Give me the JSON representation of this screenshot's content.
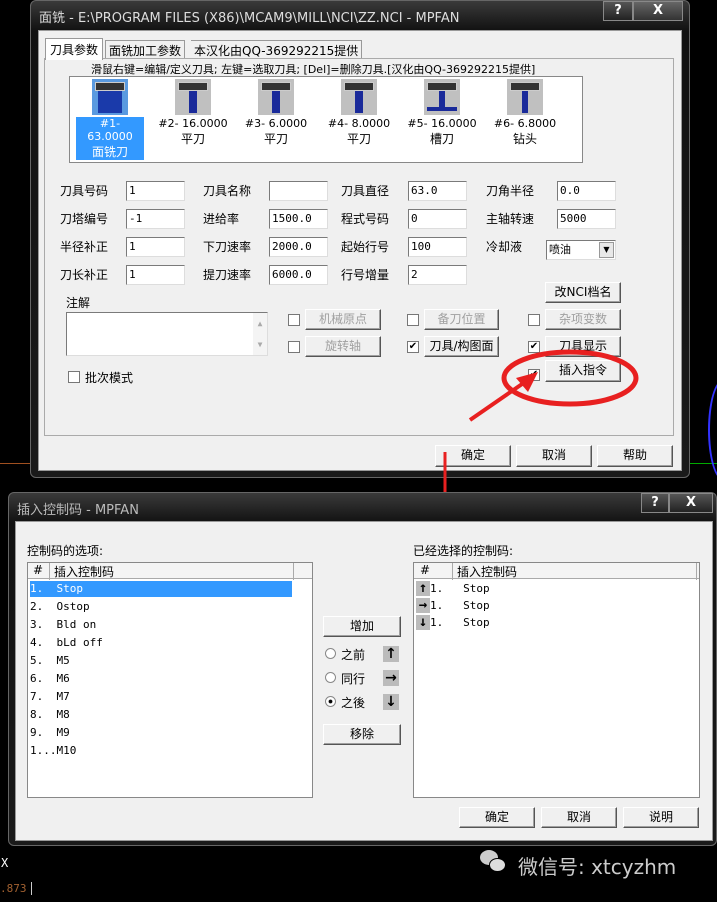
{
  "dialog1": {
    "title": "面铣 - E:\\PROGRAM FILES (X86)\\MCAM9\\MILL\\NCI\\ZZ.NCI - MPFAN",
    "help_btn": "?",
    "close_btn": "X",
    "tabs": [
      {
        "label": "刀具参数"
      },
      {
        "label": "面铣加工参数"
      },
      {
        "label": "本汉化由QQ-369292215提供"
      }
    ],
    "hint": "滑鼠右键=编辑/定义刀具; 左键=选取刀具; [Del]=删除刀具.[汉化由QQ-369292215提供]",
    "tools": [
      {
        "id": "#1- 63.0000",
        "type": "面铣刀",
        "selected": true
      },
      {
        "id": "#2- 16.0000",
        "type": "平刀"
      },
      {
        "id": "#3- 6.0000",
        "type": "平刀"
      },
      {
        "id": "#4- 8.0000",
        "type": "平刀"
      },
      {
        "id": "#5- 16.0000",
        "type": "槽刀"
      },
      {
        "id": "#6- 6.8000",
        "type": "钻头"
      }
    ],
    "fields": {
      "tool_no": {
        "label": "刀具号码",
        "value": "1"
      },
      "tool_name": {
        "label": "刀具名称",
        "value": ""
      },
      "tool_dia": {
        "label": "刀具直径",
        "value": "63.0"
      },
      "corner_rad": {
        "label": "刀角半径",
        "value": "0.0"
      },
      "turret_no": {
        "label": "刀塔编号",
        "value": "-1"
      },
      "feed": {
        "label": "进给率",
        "value": "1500.0"
      },
      "prog_no": {
        "label": "程式号码",
        "value": "0"
      },
      "spindle": {
        "label": "主轴转速",
        "value": "5000"
      },
      "dia_comp": {
        "label": "半径补正",
        "value": "1"
      },
      "plunge": {
        "label": "下刀速率",
        "value": "2000.0"
      },
      "start_line": {
        "label": "起始行号",
        "value": "100"
      },
      "coolant": {
        "label": "冷却液",
        "value": "喷油"
      },
      "len_comp": {
        "label": "刀长补正",
        "value": "1"
      },
      "retract": {
        "label": "提刀速率",
        "value": "6000.0"
      },
      "line_inc": {
        "label": "行号增量",
        "value": "2"
      }
    },
    "comment_label": "注解",
    "rename_nci": "改NCI档名",
    "options": [
      {
        "label": "机械原点",
        "checked": false,
        "disabled": true
      },
      {
        "label": "备刀位置",
        "checked": false,
        "disabled": true
      },
      {
        "label": "杂项变数",
        "checked": false,
        "disabled": true
      },
      {
        "label": "旋转轴",
        "checked": false,
        "disabled": true
      },
      {
        "label": "刀具/构图面",
        "checked": true
      },
      {
        "label": "刀具显示",
        "checked": true
      },
      {
        "label": "插入指令",
        "checked": true
      }
    ],
    "batch_mode": "批次模式",
    "ok": "确定",
    "cancel": "取消",
    "help": "帮助"
  },
  "dialog2": {
    "title": "插入控制码 - MPFAN",
    "help_btn": "?",
    "close_btn": "X",
    "left_label": "控制码的选项:",
    "right_label": "已经选择的控制码:",
    "col_hash": "#",
    "col_name": "插入控制码",
    "options": [
      "1.  Stop",
      "2.  Ostop",
      "3.  Bld on",
      "4.  bLd off",
      "5.  M5",
      "6.  M6",
      "7.  M7",
      "8.  M8",
      "9.  M9",
      "1...M10"
    ],
    "selected": [
      {
        "pos": "before",
        "text": "1.   Stop"
      },
      {
        "pos": "same",
        "text": "1.   Stop"
      },
      {
        "pos": "after",
        "text": "1.   Stop"
      }
    ],
    "add": "增加",
    "remove": "移除",
    "radios": [
      {
        "label": "之前",
        "checked": false
      },
      {
        "label": "同行",
        "checked": false
      },
      {
        "label": "之後",
        "checked": true
      }
    ],
    "ok": "确定",
    "cancel": "取消",
    "explain": "说明"
  },
  "background": {
    "axis_label": "X",
    "coord": ".873",
    "watermark": "微信号: xtcyzhm"
  }
}
